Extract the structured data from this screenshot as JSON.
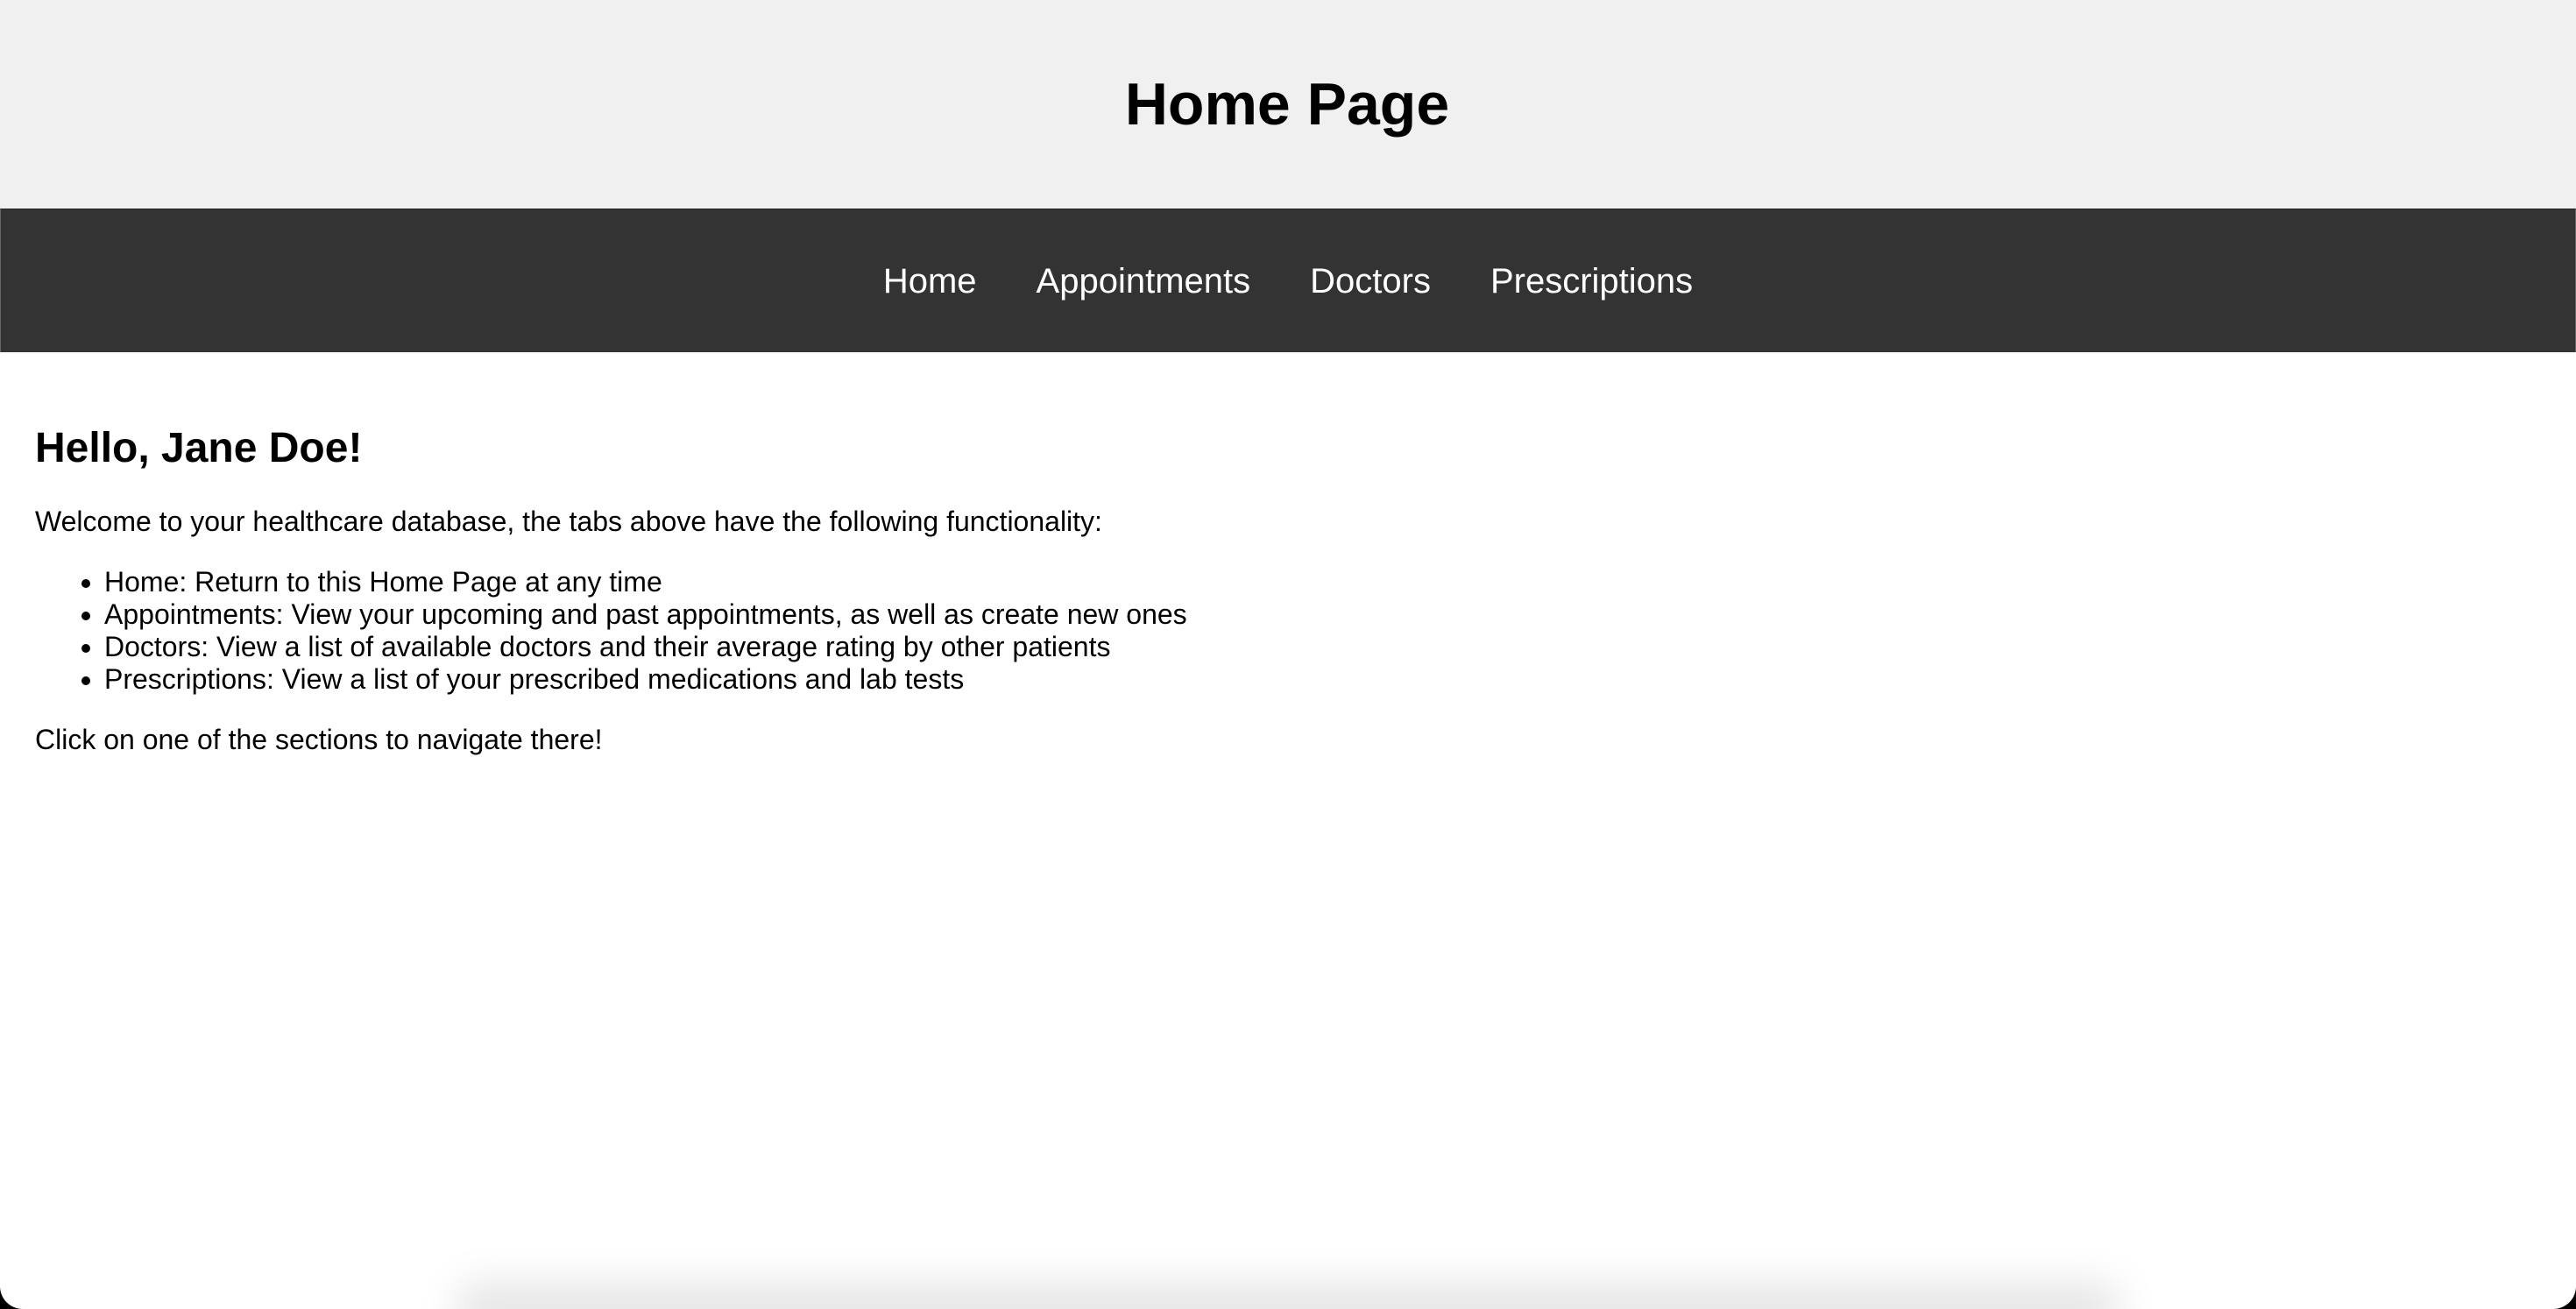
{
  "header": {
    "title": "Home Page"
  },
  "nav": {
    "items": [
      {
        "label": "Home"
      },
      {
        "label": "Appointments"
      },
      {
        "label": "Doctors"
      },
      {
        "label": "Prescriptions"
      }
    ]
  },
  "main": {
    "greeting": "Hello, Jane Doe!",
    "intro": "Welcome to your healthcare database, the tabs above have the following functionality:",
    "features": [
      "Home: Return to this Home Page at any time",
      "Appointments: View your upcoming and past appointments, as well as create new ones",
      "Doctors: View a list of available doctors and their average rating by other patients",
      "Prescriptions: View a list of your prescribed medications and lab tests"
    ],
    "outro": "Click on one of the sections to navigate there!"
  },
  "colors": {
    "header_bg": "#f0f0f0",
    "nav_bg": "#333333",
    "nav_text": "#ffffff",
    "body_bg": "#ffffff",
    "text": "#000000"
  }
}
